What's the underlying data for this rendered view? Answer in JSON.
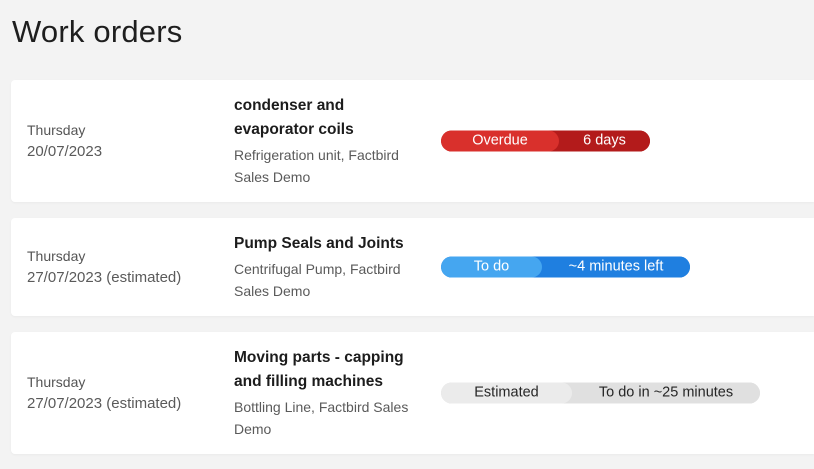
{
  "page": {
    "title": "Work orders"
  },
  "work_orders": [
    {
      "weekday": "Thursday",
      "date": "20/07/2023",
      "title_lines": [
        "condenser and",
        "evaporator coils"
      ],
      "subtitle_lines": [
        "Refrigeration unit, Factbird",
        "Sales Demo"
      ],
      "status_label": "Overdue",
      "status_detail": "6 days",
      "status_colors": {
        "primary": "#d9302c",
        "secondary": "#b31b1b"
      }
    },
    {
      "weekday": "Thursday",
      "date": "27/07/2023 (estimated)",
      "title_lines": [
        "Pump Seals and Joints"
      ],
      "subtitle_lines": [
        "Centrifugal Pump, Factbird",
        "Sales Demo"
      ],
      "status_label": "To do",
      "status_detail": "~4 minutes left",
      "status_colors": {
        "primary": "#45a6f0",
        "secondary": "#1f7fe0"
      }
    },
    {
      "weekday": "Thursday",
      "date": "27/07/2023 (estimated)",
      "title_lines": [
        "Moving parts - capping",
        "and filling machines"
      ],
      "subtitle_lines": [
        "Bottling Line, Factbird Sales",
        "Demo"
      ],
      "status_label": "Estimated",
      "status_detail": "To do in ~25 minutes",
      "status_colors": {
        "primary": "#ebebeb",
        "secondary": "#e0e0e0"
      }
    }
  ]
}
